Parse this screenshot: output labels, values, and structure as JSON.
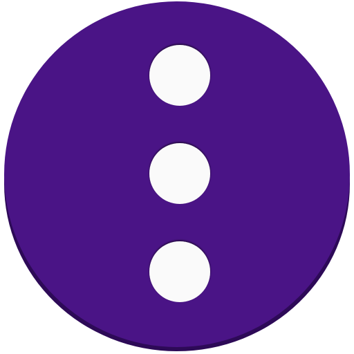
{
  "icon": {
    "name": "more-vertical-icon",
    "shape": "circle",
    "dot_count": 3
  },
  "colors": {
    "face": "#4a1486",
    "rim": "#2d0a57",
    "dot": "#fafafa",
    "dot_shadow": "#555555",
    "background": "#ffffff"
  }
}
